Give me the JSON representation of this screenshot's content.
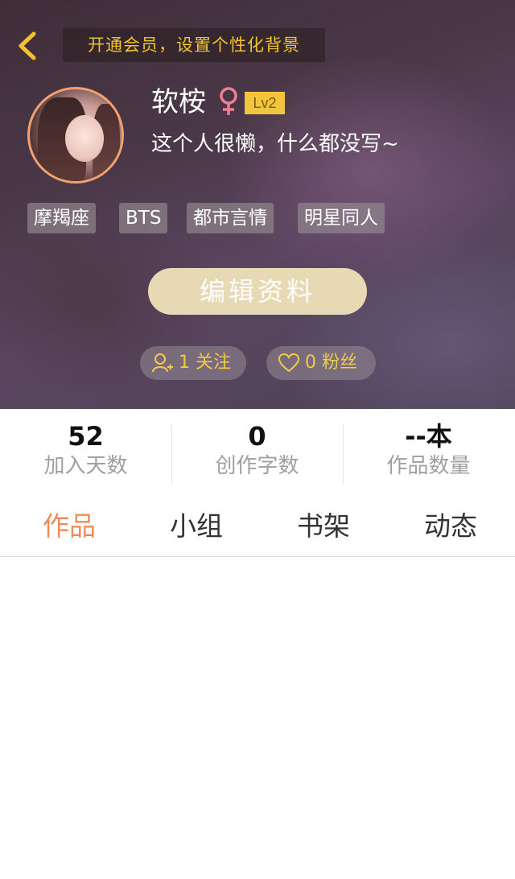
{
  "colors": {
    "accent": "#f08b57",
    "gold": "#f2c230",
    "edit_button": "#e7d9b4"
  },
  "header": {
    "vip_banner": "开通会员，设置个性化背景",
    "back_icon": "chevron-left-icon"
  },
  "profile": {
    "name": "软桉",
    "gender_icon": "female-icon",
    "level": "Lv2",
    "bio": "这个人很懒，什么都没写~",
    "tags": [
      "摩羯座",
      "BTS",
      "都市言情",
      "明星同人"
    ],
    "edit_button": "编辑资料",
    "follow_text": "1 关注",
    "fans_text": "0 粉丝"
  },
  "stats": [
    {
      "value": "52",
      "label": "加入天数"
    },
    {
      "value": "0",
      "label": "创作字数"
    },
    {
      "value": "--本",
      "label": "作品数量"
    }
  ],
  "tabs": [
    {
      "label": "作品",
      "active": true
    },
    {
      "label": "小组",
      "active": false
    },
    {
      "label": "书架",
      "active": false
    },
    {
      "label": "动态",
      "active": false
    }
  ]
}
